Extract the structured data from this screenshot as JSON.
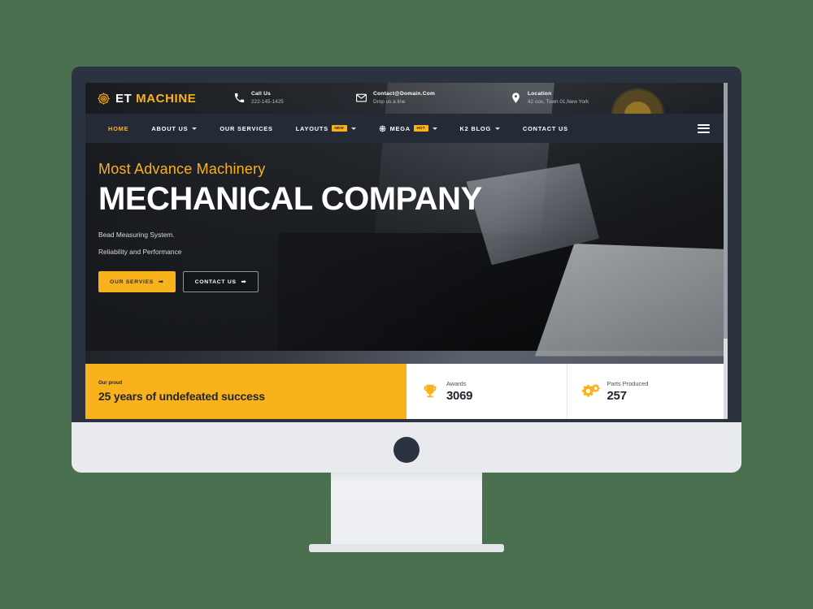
{
  "theme": {
    "accent": "#F9B21C",
    "nav_bg": "#252b36",
    "bezel": "#2b3240",
    "page_bg": "#4a7050"
  },
  "device": {
    "name": "desktop-monitor-mockup"
  },
  "site": {
    "logo": {
      "icon": "gear-logo-icon",
      "text_primary": "ET",
      "text_accent": "MACHINE"
    },
    "topbar": [
      {
        "icon": "phone-icon",
        "title": "Call Us",
        "sub": "222-145-1425"
      },
      {
        "icon": "envelope-icon",
        "title": "Contact@Domain.Com",
        "sub": "Drop us a line"
      },
      {
        "icon": "map-pin-icon",
        "title": "Location",
        "sub": "42 oos, Town 01,New York"
      }
    ],
    "nav": {
      "items": [
        {
          "label": "HOME",
          "active": true,
          "caret": false,
          "badge": "",
          "icon": ""
        },
        {
          "label": "ABOUT US",
          "active": false,
          "caret": true,
          "badge": "",
          "icon": ""
        },
        {
          "label": "OUR SERVICES",
          "active": false,
          "caret": false,
          "badge": "",
          "icon": ""
        },
        {
          "label": "LAYOUTS",
          "active": false,
          "caret": true,
          "badge": "NEW",
          "icon": ""
        },
        {
          "label": "MEGA",
          "active": false,
          "caret": true,
          "badge": "HOT",
          "icon": "mega-menu-icon"
        },
        {
          "label": "K2 BLOG",
          "active": false,
          "caret": true,
          "badge": "",
          "icon": ""
        },
        {
          "label": "CONTACT US",
          "active": false,
          "caret": false,
          "badge": "",
          "icon": ""
        }
      ],
      "toggle_icon": "hamburger-icon"
    },
    "hero": {
      "pretitle": "Most Advance Machinery",
      "title": "MECHANICAL COMPANY",
      "sub1": "Bead Measuring System.",
      "sub2": "Reliability and Performance",
      "buttons": [
        {
          "label": "OUR SERVIES",
          "arrow": "➡",
          "style": "primary"
        },
        {
          "label": "CONTACT US",
          "arrow": "➡",
          "style": "ghost"
        }
      ]
    },
    "stats": {
      "proud_small": "Our proud",
      "proud_big": "25 years of undefeated success",
      "items": [
        {
          "icon": "trophy-icon",
          "label": "Awards",
          "value": "3069"
        },
        {
          "icon": "gears-icon",
          "label": "Parts Produced",
          "value": "257"
        }
      ]
    }
  }
}
